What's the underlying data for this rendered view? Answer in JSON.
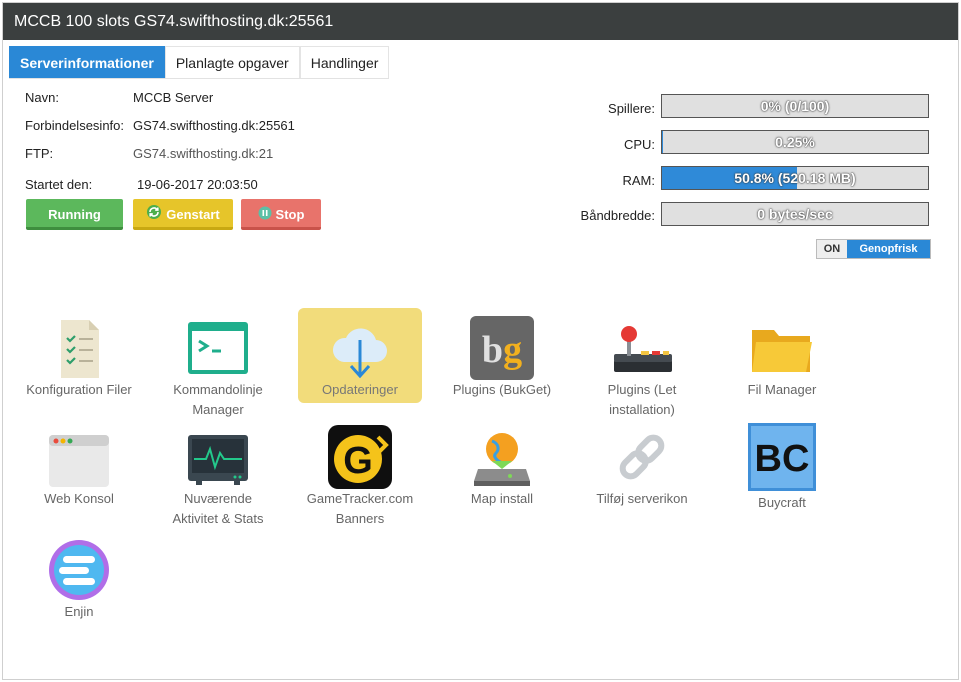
{
  "header": {
    "title": "MCCB 100 slots GS74.swifthosting.dk:25561"
  },
  "tabs": [
    {
      "label": "Serverinformationer",
      "active": true
    },
    {
      "label": "Planlagte opgaver",
      "active": false
    },
    {
      "label": "Handlinger",
      "active": false
    }
  ],
  "info": {
    "name_label": "Navn:",
    "name_value": "MCCB Server",
    "conn_label": "Forbindelsesinfo:",
    "conn_value": "GS74.swifthosting.dk:25561",
    "ftp_label": "FTP:",
    "ftp_value": "GS74.swifthosting.dk:21",
    "started_label": "Startet den:",
    "started_value": "19-06-2017 20:03:50"
  },
  "buttons": {
    "running": "Running",
    "restart": "Genstart",
    "stop": "Stop"
  },
  "stats": [
    {
      "label": "Spillere:",
      "text": "0% (0/100)",
      "fraction": 0.0
    },
    {
      "label": "CPU:",
      "text": "0.25%",
      "fraction": 0.0025
    },
    {
      "label": "RAM:",
      "text": "50.8% (520.18 MB)",
      "fraction": 0.508
    },
    {
      "label": "Båndbredde:",
      "text": "0 bytes/sec",
      "fraction": 0.0
    }
  ],
  "toggle": {
    "on": "ON",
    "refresh": "Genopfrisk"
  },
  "tiles": [
    {
      "name": "config-files",
      "label1": "Konfiguration Filer",
      "label2": "",
      "icon": "checklist-icon"
    },
    {
      "name": "command-line",
      "label1": "Kommandolinje",
      "label2": "Manager",
      "icon": "terminal-icon"
    },
    {
      "name": "updates",
      "label1": "Opdateringer",
      "label2": "",
      "icon": "cloud-download-icon",
      "active": true
    },
    {
      "name": "plugins-bukget",
      "label1": "Plugins (BukGet)",
      "label2": "",
      "icon": "bukget-icon"
    },
    {
      "name": "plugins-easy",
      "label1": "Plugins (Let",
      "label2": "installation)",
      "icon": "joystick-icon"
    },
    {
      "name": "file-manager",
      "label1": "Fil Manager",
      "label2": "",
      "icon": "folder-icon"
    },
    {
      "name": "web-console",
      "label1": "Web Konsol",
      "label2": "",
      "icon": "browser-window-icon"
    },
    {
      "name": "activity-stats",
      "label1": "Nuværende",
      "label2": "Aktivitet & Stats",
      "icon": "monitor-pulse-icon"
    },
    {
      "name": "gametracker-banners",
      "label1": "GameTracker.com",
      "label2": "Banners",
      "icon": "gametracker-icon"
    },
    {
      "name": "map-install",
      "label1": "Map install",
      "label2": "",
      "icon": "map-install-icon"
    },
    {
      "name": "server-icon",
      "label1": "Tilføj serverikon",
      "label2": "",
      "icon": "chain-link-icon"
    },
    {
      "name": "buycraft",
      "label1": "Buycraft",
      "label2": "",
      "icon": "buycraft-icon"
    },
    {
      "name": "enjin",
      "label1": "Enjin",
      "label2": "",
      "icon": "enjin-icon"
    }
  ],
  "icon_text": {
    "bukget": "bg",
    "gametracker": "G",
    "buycraft": "BC"
  },
  "colors": {
    "accent": "#2a88d6",
    "running": "#5cb85c",
    "restart": "#e6c52a",
    "stop": "#e8736b"
  }
}
